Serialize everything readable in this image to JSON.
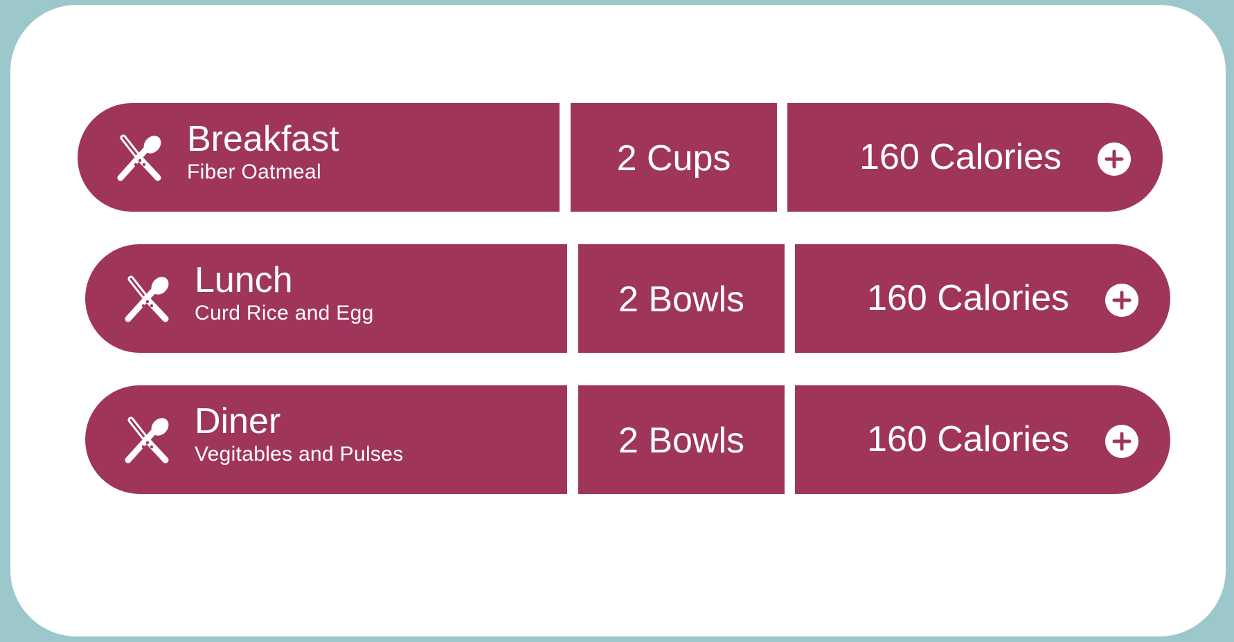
{
  "meals": [
    {
      "name": "Breakfast",
      "description": "Fiber Oatmeal",
      "quantity": "2 Cups",
      "calories": "160 Calories",
      "icon": "fork-spoon-icon",
      "action_icon": "plus-circle-icon"
    },
    {
      "name": "Lunch",
      "description": "Curd Rice and Egg",
      "quantity": "2 Bowls",
      "calories": "160 Calories",
      "icon": "fork-spoon-icon",
      "action_icon": "plus-circle-icon"
    },
    {
      "name": "Diner",
      "description": "Vegitables and Pulses",
      "quantity": "2 Bowls",
      "calories": "160 Calories",
      "icon": "fork-spoon-icon",
      "action_icon": "plus-circle-icon"
    }
  ],
  "colors": {
    "background": "#9cc7cb",
    "card": "#ffffff",
    "row": "#a0355c",
    "text": "#ffffff"
  }
}
